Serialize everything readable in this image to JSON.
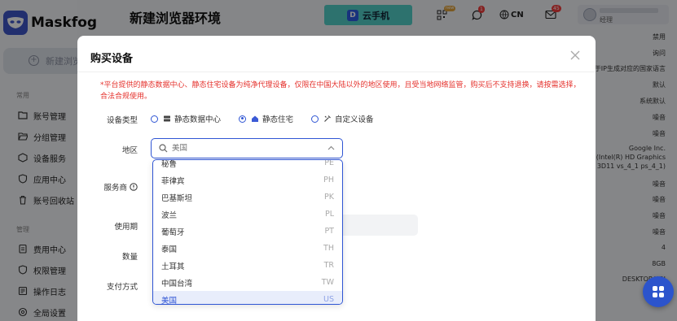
{
  "app": {
    "name": "Maskfog"
  },
  "sidebar": {
    "new_env_label": "新建浏览",
    "group_common": "常用",
    "group_manage": "管理",
    "items": [
      {
        "label": "账号管理",
        "icon": "folder-icon"
      },
      {
        "label": "分组管理",
        "icon": "folder-open-icon"
      },
      {
        "label": "设备服务",
        "icon": "box-icon"
      },
      {
        "label": "应用中心",
        "icon": "shield-icon"
      },
      {
        "label": "账号回收站",
        "icon": "trash-icon"
      },
      {
        "label": "费用中心",
        "icon": "clipboard-icon"
      },
      {
        "label": "权限管理",
        "icon": "shield-icon"
      },
      {
        "label": "操作日志",
        "icon": "log-icon"
      },
      {
        "label": "全局设置",
        "icon": "gear-icon"
      }
    ]
  },
  "header": {
    "title": "新建浏览器环境",
    "cloud_phone": "云手机",
    "language": "CN",
    "badges": {
      "notify": "1",
      "messages": "45",
      "qr": "new"
    },
    "user_role": "经理"
  },
  "background_values": [
    "禁用",
    "询问",
    "于IP生成对应的国家语言",
    "默认",
    "系统默认",
    "噪音",
    "噪音",
    "Google Inc.",
    "(Intel(R) HD Graphics",
    "3D11 vs_4_1 ps_4_1)",
    "噪音",
    "噪音",
    "噪音",
    "噪音",
    "4",
    "8GB",
    "DESKTOP-WN"
  ],
  "modal": {
    "title": "购买设备",
    "notice": "*平台提供的静态数据中心、静态住宅设备为纯净代理设备，仅限在中国大陆以外的地区使用，且受当地网络监管，购买后不支持退换，请按需选择，合法合规使用。",
    "labels": {
      "device_type": "设备类型",
      "region": "地区",
      "provider": "服务商",
      "period": "使用期",
      "quantity": "数量",
      "payment": "支付方式"
    },
    "device_types": [
      {
        "label": "静态数据中心",
        "checked": false,
        "icon": "server-icon"
      },
      {
        "label": "静态住宅",
        "checked": true,
        "icon": "home-icon"
      },
      {
        "label": "自定义设备",
        "checked": false,
        "icon": "tools-icon"
      }
    ],
    "region": {
      "placeholder": "美国"
    },
    "region_options": [
      {
        "name": "秘鲁",
        "code": "PE"
      },
      {
        "name": "菲律宾",
        "code": "PH"
      },
      {
        "name": "巴基斯坦",
        "code": "PK"
      },
      {
        "name": "波兰",
        "code": "PL"
      },
      {
        "name": "葡萄牙",
        "code": "PT"
      },
      {
        "name": "泰国",
        "code": "TH"
      },
      {
        "name": "土耳其",
        "code": "TR"
      },
      {
        "name": "中国台湾",
        "code": "TW"
      },
      {
        "name": "美国",
        "code": "US",
        "selected": true
      }
    ]
  },
  "colors": {
    "primary": "#2f55d4",
    "notice": "#e5322d",
    "brand": "#3e56c8"
  }
}
